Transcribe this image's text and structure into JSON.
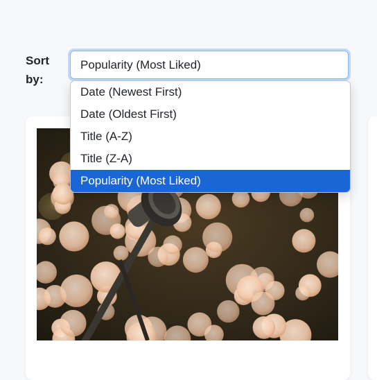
{
  "sort": {
    "label": "Sort by:",
    "selected": "Popularity (Most Liked)",
    "options": [
      "Date (Newest First)",
      "Date (Oldest First)",
      "Title (A-Z)",
      "Title (Z-A)",
      "Popularity (Most Liked)"
    ],
    "selected_index": 4
  },
  "card": {
    "image": "microphone-bokeh-photo"
  },
  "colors": {
    "page_background": "#f6f8fb",
    "focus_border": "#86b7fe",
    "selected_option": "#1a66d6"
  }
}
